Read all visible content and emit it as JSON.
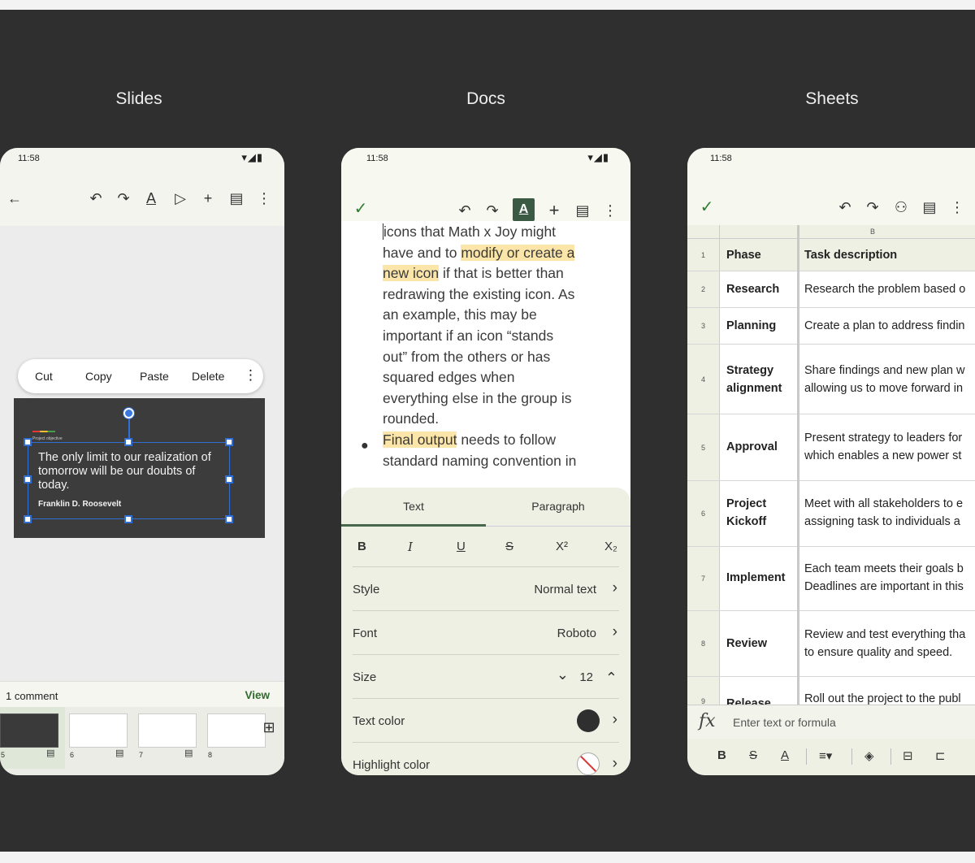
{
  "titles": {
    "slides": "Slides",
    "docs": "Docs",
    "sheets": "Sheets"
  },
  "status": {
    "time": "11:58",
    "system_icons": "▾◢▮"
  },
  "slides": {
    "context_menu": [
      "Cut",
      "Copy",
      "Paste",
      "Delete"
    ],
    "slide": {
      "label": "Project objective",
      "quote": "The only limit to our realization of tomorrow will be our doubts of today.",
      "author": "Franklin D. Roosevelt"
    },
    "comments": {
      "count": "1 comment",
      "view": "View"
    },
    "thumbnails": [
      "5",
      "6",
      "7",
      "8"
    ]
  },
  "docs": {
    "toolbar_a": "A",
    "body_lines": [
      [
        "icons that Math x Joy might",
        ""
      ],
      [
        "have and to ",
        "modify or create a"
      ],
      [
        "",
        "new icon",
        " if that is better than"
      ],
      [
        "redrawing the existing icon. As"
      ],
      [
        "an example, this may be"
      ],
      [
        "important if an icon “stands"
      ],
      [
        "out” from the others or has"
      ],
      [
        "squared edges when"
      ],
      [
        "everything else in the group is"
      ],
      [
        "rounded."
      ]
    ],
    "bullet": {
      "highlight": "Final output",
      "rest": " needs to follow",
      "line2": "standard naming convention in"
    },
    "tabs": [
      "Text",
      "Paragraph"
    ],
    "format_buttons": [
      "B",
      "I",
      "U",
      "S",
      "X²",
      "X₂"
    ],
    "rows": {
      "style": {
        "label": "Style",
        "value": "Normal text"
      },
      "font": {
        "label": "Font",
        "value": "Roboto"
      },
      "size": {
        "label": "Size",
        "value": "12"
      },
      "text_color": {
        "label": "Text color"
      },
      "highlight_color": {
        "label": "Highlight color"
      }
    }
  },
  "sheets": {
    "column_b": "B",
    "header": {
      "num": "1",
      "phase": "Phase",
      "desc": "Task description"
    },
    "rows": [
      {
        "num": "2",
        "phase": [
          "Research"
        ],
        "desc": [
          "Research the problem based o"
        ]
      },
      {
        "num": "3",
        "phase": [
          "Planning"
        ],
        "desc": [
          "Create a plan to address findin"
        ]
      },
      {
        "num": "4",
        "phase": [
          "Strategy",
          "alignment"
        ],
        "desc": [
          "Share findings and new plan w",
          "allowing us to move forward in"
        ]
      },
      {
        "num": "5",
        "phase": [
          "Approval"
        ],
        "desc": [
          "Present strategy to leaders for",
          "which enables a new power st"
        ]
      },
      {
        "num": "6",
        "phase": [
          "Project",
          "Kickoff"
        ],
        "desc": [
          "Meet with all stakeholders to e",
          "assigning task to individuals a"
        ]
      },
      {
        "num": "7",
        "phase": [
          "Implement"
        ],
        "desc": [
          "Each team meets their goals b",
          "Deadlines are important in this"
        ]
      },
      {
        "num": "8",
        "phase": [
          "Review"
        ],
        "desc": [
          "Review and test everything tha",
          "to ensure quality and speed."
        ]
      },
      {
        "num": "9",
        "phase": [
          "Release"
        ],
        "desc": [
          "Roll out the project to the publ"
        ]
      }
    ],
    "formula_placeholder": "Enter text or formula",
    "fx": "fx"
  }
}
